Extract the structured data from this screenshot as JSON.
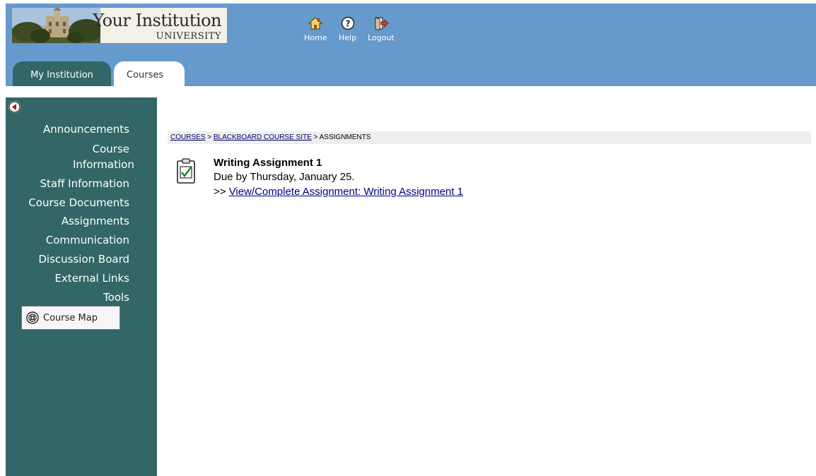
{
  "logo": {
    "title": "Your Institution",
    "subtitle": "UNIVERSITY"
  },
  "topnav": {
    "home": "Home",
    "help": "Help",
    "logout": "Logout"
  },
  "tabs": [
    {
      "label": "My Institution",
      "active": false
    },
    {
      "label": "Courses",
      "active": true
    }
  ],
  "sidebar": {
    "items": [
      {
        "label": "Announcements"
      },
      {
        "label": "Course Information"
      },
      {
        "label": "Staff Information"
      },
      {
        "label": "Course Documents"
      },
      {
        "label": "Assignments"
      },
      {
        "label": "Communication"
      },
      {
        "label": "Discussion Board"
      },
      {
        "label": "External Links"
      },
      {
        "label": "Tools"
      }
    ],
    "course_map": "Course Map"
  },
  "breadcrumb": {
    "items": [
      "COURSES",
      "BLACKBOARD COURSE SITE",
      "ASSIGNMENTS"
    ],
    "separator": " > "
  },
  "assignment": {
    "title": "Writing Assignment 1",
    "due": "Due by Thursday, January 25.",
    "link_prefix": ">> ",
    "link_label": "View/Complete Assignment: Writing Assignment 1"
  },
  "colors": {
    "header_bg": "#6699cc",
    "sidebar_bg": "#336666",
    "tab_inactive_bg": "#336666",
    "link": "#000080"
  }
}
